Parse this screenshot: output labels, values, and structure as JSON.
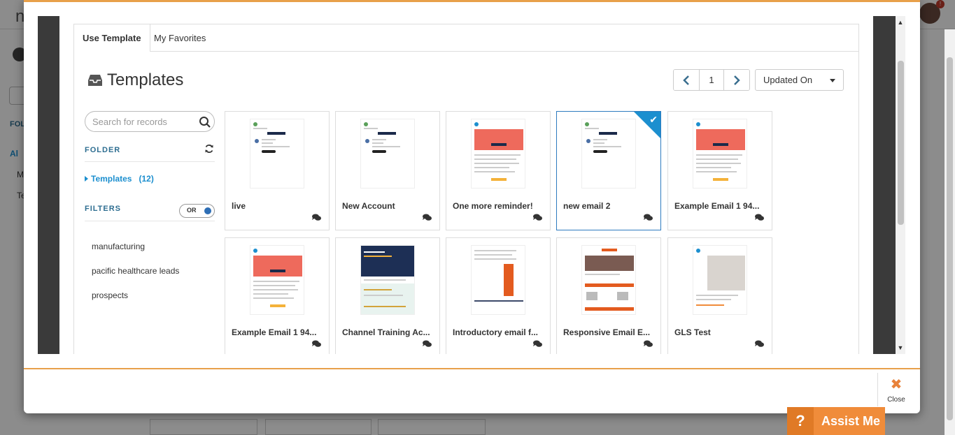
{
  "background": {
    "logo_text": "n",
    "left_labels": {
      "folder": "FOL",
      "all": "Al",
      "m": "M",
      "te": "Te"
    }
  },
  "tabs": [
    {
      "label": "Use Template",
      "active": true
    },
    {
      "label": "My Favorites",
      "active": false
    }
  ],
  "header": {
    "title": "Templates",
    "title_icon": "inbox-icon"
  },
  "pager": {
    "current_page": "1",
    "prev_icon": "chevron-left-icon",
    "next_icon": "chevron-right-icon"
  },
  "sort": {
    "selected": "Updated On"
  },
  "sidebar": {
    "search_placeholder": "Search for records",
    "folder_label": "FOLDER",
    "folders": [
      {
        "name": "Templates",
        "count": "(12)"
      }
    ],
    "filters_label": "FILTERS",
    "filter_toggle_label": "OR",
    "filters": [
      "manufacturing",
      "pacific healthcare leads",
      "prospects"
    ]
  },
  "templates": [
    {
      "name": "live",
      "style": "blue-simple",
      "selected": false
    },
    {
      "name": "New Account",
      "style": "blue-simple",
      "selected": false
    },
    {
      "name": "One more reminder!",
      "style": "red-banner",
      "selected": false
    },
    {
      "name": "new email 2",
      "style": "blue-simple",
      "selected": true
    },
    {
      "name": "Example Email 1 94...",
      "style": "red-banner",
      "selected": false
    },
    {
      "name": "Example Email 1 94...",
      "style": "red-banner",
      "selected": false
    },
    {
      "name": "Channel Training Ac...",
      "style": "dark-green",
      "selected": false
    },
    {
      "name": "Introductory email f...",
      "style": "orange-bar",
      "selected": false
    },
    {
      "name": "Responsive Email E...",
      "style": "image-orange",
      "selected": false
    },
    {
      "name": "GLS Test",
      "style": "photo",
      "selected": false
    }
  ],
  "footer": {
    "close_label": "Close"
  },
  "assist": {
    "label": "Assist Me",
    "icon": "?"
  },
  "colors": {
    "accent_orange": "#e8a04a",
    "link_blue": "#1c8fcf",
    "label_blue": "#2e6e91",
    "selected_border": "#2e7bbf"
  }
}
